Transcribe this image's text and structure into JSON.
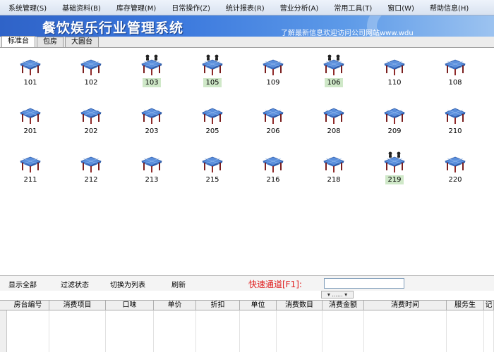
{
  "menu": [
    "系统管理(S)",
    "基础资料(B)",
    "库存管理(M)",
    "日常操作(Z)",
    "统计报表(R)",
    "营业分析(A)",
    "常用工具(T)",
    "窗口(W)",
    "帮助信息(H)"
  ],
  "banner": {
    "title": "餐饮娱乐行业管理系统",
    "marquee": "了解最新信息欢迎访问公司网站www.wdu"
  },
  "tabs": [
    "标准台",
    "包房",
    "大圆台"
  ],
  "active_tab": 0,
  "tables": [
    {
      "num": "101",
      "occupied": false
    },
    {
      "num": "102",
      "occupied": false
    },
    {
      "num": "103",
      "occupied": true
    },
    {
      "num": "105",
      "occupied": true
    },
    {
      "num": "109",
      "occupied": false
    },
    {
      "num": "106",
      "occupied": true
    },
    {
      "num": "110",
      "occupied": false
    },
    {
      "num": "108",
      "occupied": false
    },
    {
      "num": "201",
      "occupied": false
    },
    {
      "num": "202",
      "occupied": false
    },
    {
      "num": "203",
      "occupied": false
    },
    {
      "num": "205",
      "occupied": false
    },
    {
      "num": "206",
      "occupied": false
    },
    {
      "num": "208",
      "occupied": false
    },
    {
      "num": "209",
      "occupied": false
    },
    {
      "num": "210",
      "occupied": false
    },
    {
      "num": "211",
      "occupied": false
    },
    {
      "num": "212",
      "occupied": false
    },
    {
      "num": "213",
      "occupied": false
    },
    {
      "num": "215",
      "occupied": false
    },
    {
      "num": "216",
      "occupied": false
    },
    {
      "num": "218",
      "occupied": false
    },
    {
      "num": "219",
      "occupied": true
    },
    {
      "num": "220",
      "occupied": false
    }
  ],
  "toolbar": {
    "show_all": "显示全部",
    "filter_status": "过滤状态",
    "switch_list": "切换为列表",
    "refresh": "刷新",
    "quick_channel": "快速通道[F1]:",
    "quick_input_value": ""
  },
  "mini_dropdown": "▾ ...... ▾",
  "columns": [
    "房台编号",
    "消费项目",
    "口味",
    "单价",
    "折扣",
    "单位",
    "消费数目",
    "消费金额",
    "消费时间",
    "服务生",
    "记"
  ],
  "colors": {
    "occupied_label_bg": "#cfe8c8",
    "quick_label": "#e02020",
    "banner_start": "#2f63c8"
  }
}
